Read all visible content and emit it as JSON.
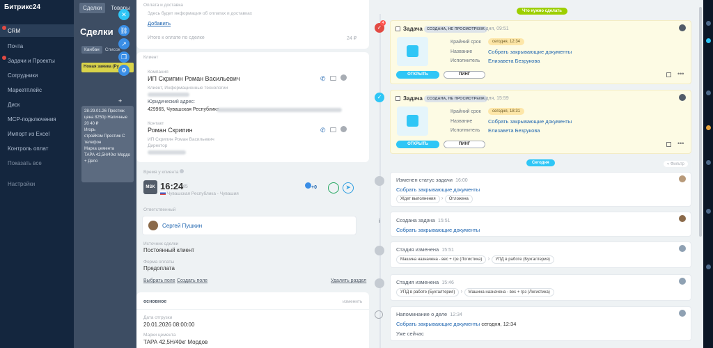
{
  "sidebar": {
    "logo": "Битрикс24",
    "items": [
      {
        "label": "CRM",
        "active": true,
        "badge": true
      },
      {
        "label": "Почта"
      },
      {
        "label": "Задачи и Проекты",
        "badge": true
      },
      {
        "label": "Сотрудники"
      },
      {
        "label": "Маркетплейс"
      },
      {
        "label": "Диск"
      },
      {
        "label": "МСР-подключения"
      },
      {
        "label": "Импорт из Excel"
      },
      {
        "label": "Контроль оплат"
      },
      {
        "label": "Показать все"
      },
      {
        "label": "Настройки"
      }
    ]
  },
  "background": {
    "tabs": [
      "Сделки",
      "Товары"
    ],
    "title": "Сделки",
    "view_tabs": [
      "Канбан",
      "Список"
    ],
    "column_title": "Новая заявка (Ру",
    "card_lines": [
      "28-29.01.26 Престиж",
      "цена 8250р Наличные",
      "20 40 ₽",
      "Игорь",
      "стройКом Престиж С",
      "телефон",
      "Марка цемента",
      "ТАРА 42,5Н/40кг Мордо",
      "+ Дело"
    ]
  },
  "card": {
    "payment": {
      "title": "Оплата и доставка",
      "note": "Здесь будет информация об оплатах и доставках",
      "add_link": "Добавить",
      "total_label": "Итого к оплате по сделке",
      "total_value": "24 ₽"
    },
    "client": {
      "section_label": "Клиент",
      "company_label": "Компания",
      "company_name": "ИП Скрипин Роман Васильевич",
      "company_sub": "Клиент, Информационные технологии",
      "address_label": "Юридический адрес:",
      "address_value": "429965, Чувашская Республика",
      "contact_label": "Контакт",
      "contact_name": "Роман Скрипин",
      "contact_company": "ИП Скрипин Роман Васильевич",
      "contact_role": "Директор"
    },
    "client_time": {
      "label": "Время у клиента",
      "icon_text": "MSK",
      "time": "16:24",
      "seconds": "45",
      "region": "Чувашская Республика - Чувашия",
      "channels_count": "+0"
    },
    "responsible": {
      "label": "Ответственный",
      "name": "Сергей Пушкин"
    },
    "source": {
      "label": "Источник сделки",
      "value": "Постоянный клиент"
    },
    "pay_form": {
      "label": "Форма оплаты",
      "value": "Предоплата"
    },
    "links": {
      "select_field": "Выбрать поле",
      "create_field": "Создать поле",
      "delete_section": "Удалить раздел"
    },
    "main": {
      "title": "основное",
      "edit": "изменить",
      "ship_label": "Дата отгрузки",
      "ship_value": "20.01.2026 08:00:00",
      "cement_label": "Марки цемента",
      "cement_value": "ТАРА 42,5Н/40кг Мордов"
    }
  },
  "timeline": {
    "todo_pill": "Что нужно сделать",
    "today_pill": "Сегодня",
    "filter": "Фильтр",
    "tasks": [
      {
        "title": "Задача",
        "badge": "СОЗДАНА, НЕ ПРОСМОТРЕНА",
        "time": "сегодня, 09:51",
        "deadline_label": "Крайний срок",
        "deadline_value": "сегодня, 12:34",
        "name_label": "Название",
        "name_value": "Собрать закрывающие документы",
        "exec_label": "Исполнитель",
        "exec_value": "Елизавета Безрукова",
        "open": "ОТКРЫТЬ",
        "ping": "ПИНГ",
        "counter": "4"
      },
      {
        "title": "Задача",
        "badge": "СОЗДАНА, НЕ ПРОСМОТРЕНА",
        "time": "сегодня, 15:59",
        "deadline_label": "Крайний срок",
        "deadline_value": "сегодня, 18:31",
        "name_label": "Название",
        "name_value": "Собрать закрывающие документы",
        "exec_label": "Исполнитель",
        "exec_value": "Елизавета Безрукова",
        "open": "ОТКРЫТЬ",
        "ping": "ПИНГ"
      }
    ],
    "events": [
      {
        "title": "Изменен статус задачи",
        "time": "16:00",
        "link": "Собрать закрывающие документы",
        "from": "Ждет выполнения",
        "to": "Отложена"
      },
      {
        "title": "Создана задача",
        "time": "15:51",
        "link": "Собрать закрывающие документы"
      },
      {
        "title": "Стадия изменена",
        "time": "15:51",
        "from": "Машина назначена - вес + грз (Логистика)",
        "to": "УПД в работе (Бухгалтерия)"
      },
      {
        "title": "Стадия изменена",
        "time": "15:46",
        "from": "УПД в работе (Бухгалтерия)",
        "to": "Машина назначена - вес + грз (Логистика)"
      },
      {
        "title": "Напоминание о деле",
        "time": "12:34",
        "link": "Собрать закрывающие документы",
        "link_suffix": "сегодня, 12:34",
        "note": "Уже сейчас"
      }
    ]
  },
  "colors": {
    "accent": "#2fc6f6",
    "link": "#2066b0",
    "sidebar": "#14263e",
    "task_bg": "#fdfbe4",
    "alert": "#e24a43"
  }
}
